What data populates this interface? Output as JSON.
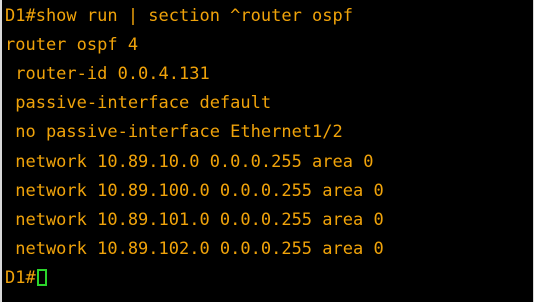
{
  "terminal": {
    "lines": [
      "D1#show run | section ^router ospf",
      "router ospf 4",
      " router-id 0.0.4.131",
      " passive-interface default",
      " no passive-interface Ethernet1/2",
      " network 10.89.10.0 0.0.0.255 area 0",
      " network 10.89.100.0 0.0.0.255 area 0",
      " network 10.89.101.0 0.0.0.255 area 0",
      " network 10.89.102.0 0.0.0.255 area 0"
    ],
    "prompt": "D1#"
  },
  "colors": {
    "background": "#000000",
    "text": "#f0a30a",
    "cursor": "#2bd52b"
  }
}
